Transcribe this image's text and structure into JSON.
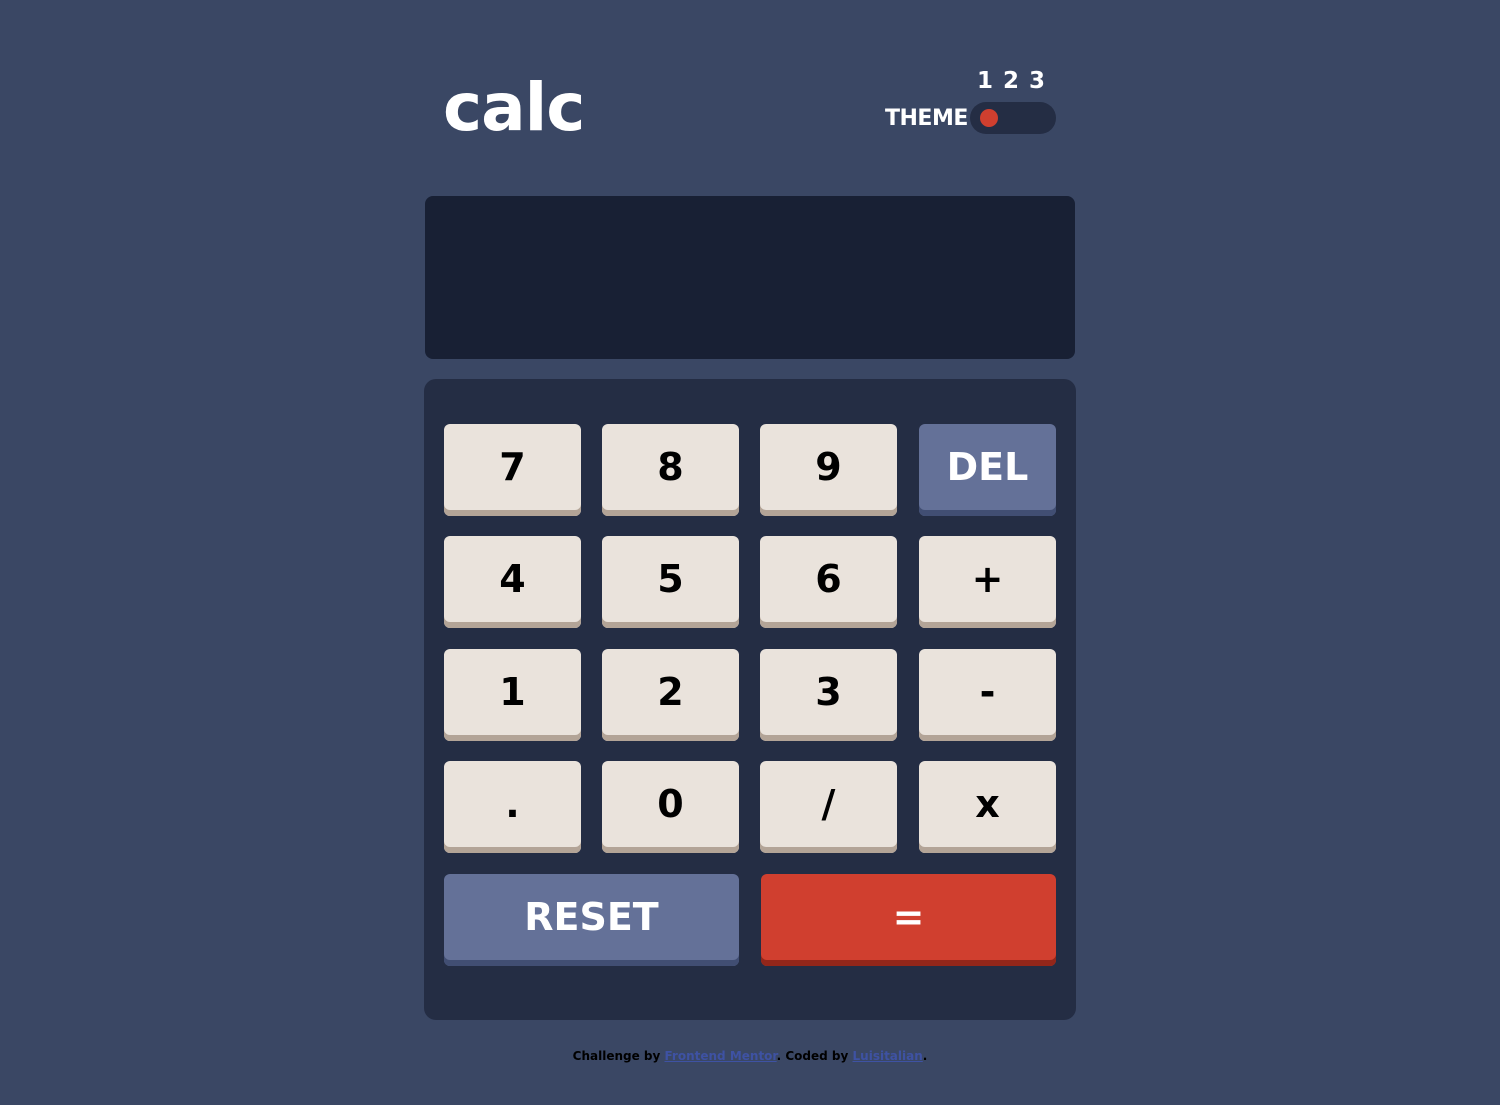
{
  "header": {
    "logo": "calc",
    "theme_label": "THEME",
    "theme_numbers": [
      "1",
      "2",
      "3"
    ],
    "active_theme": 1
  },
  "screen": {
    "value": ""
  },
  "keys": {
    "row1": [
      "7",
      "8",
      "9",
      "DEL"
    ],
    "row2": [
      "4",
      "5",
      "6",
      "+"
    ],
    "row3": [
      "1",
      "2",
      "3",
      "-"
    ],
    "row4": [
      ".",
      "0",
      "/",
      "x"
    ],
    "reset": "RESET",
    "equals": "="
  },
  "footer": {
    "prefix": "Challenge by ",
    "link1": "Frontend Mentor",
    "middle": ". Coded by ",
    "link2": "Luisitalian",
    "suffix": "."
  },
  "colors": {
    "background": "#3a4764",
    "keypad": "#242d44",
    "screen": "#182034",
    "key": "#eae3dc",
    "key_shadow": "#b3a497",
    "accent_blue": "#647198",
    "accent_red": "#d03f2f"
  }
}
